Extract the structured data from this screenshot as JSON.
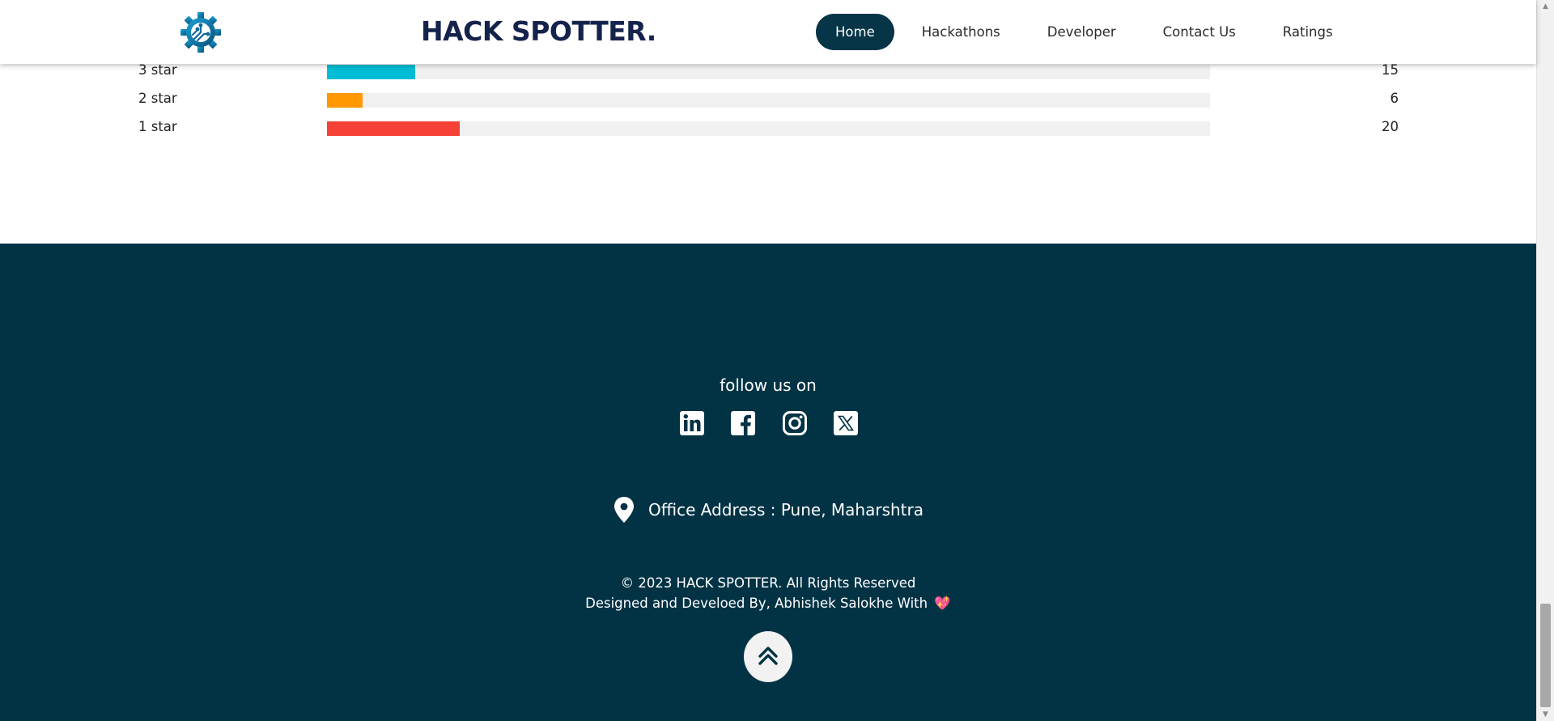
{
  "navbar": {
    "brand": "HACK SPOTTER.",
    "logo_icon": "gear-circuit-icon",
    "links": [
      {
        "label": "Home",
        "active": true
      },
      {
        "label": "Hackathons",
        "active": false
      },
      {
        "label": "Developer",
        "active": false
      },
      {
        "label": "Contact Us",
        "active": false
      },
      {
        "label": "Ratings",
        "active": false
      }
    ]
  },
  "ratings": {
    "rows": [
      {
        "label": "3 star",
        "count": "15",
        "fraction": 0.1,
        "color": "#00bcd4"
      },
      {
        "label": "2 star",
        "count": "6",
        "fraction": 0.04,
        "color": "#ff9800"
      },
      {
        "label": "1 star",
        "count": "20",
        "fraction": 0.15,
        "color": "#f44336"
      }
    ]
  },
  "footer": {
    "follow_text": "follow us on",
    "socials": [
      {
        "name": "linkedin-icon"
      },
      {
        "name": "facebook-icon"
      },
      {
        "name": "instagram-icon"
      },
      {
        "name": "x-twitter-icon"
      }
    ],
    "address_icon": "location-pin-icon",
    "address": "Office Address : Pune, Maharshtra",
    "copyright": "© 2023 HACK SPOTTER. All Rights Reserved",
    "credits": "Designed and Develoed By, Abhishek Salokhe With",
    "heart": "💖",
    "back_to_top_icon": "double-chevron-up-icon"
  },
  "colors": {
    "footer_bg": "#023345",
    "nav_active_bg": "#053547",
    "brand": "#14234b"
  }
}
